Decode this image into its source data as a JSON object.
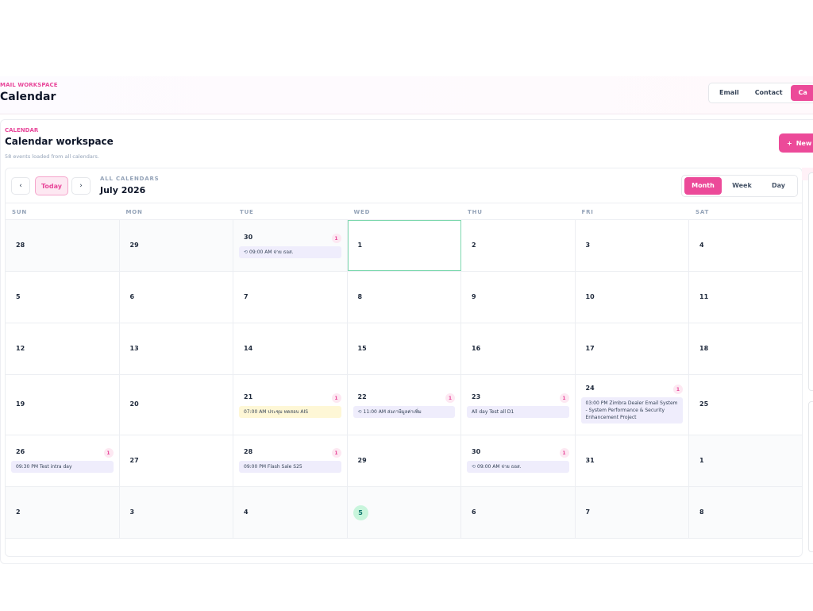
{
  "app": {
    "kicker": "MAIL WORKSPACE",
    "title": "Calendar",
    "nav": [
      {
        "label": "Email",
        "active": false
      },
      {
        "label": "Contact",
        "active": false
      },
      {
        "label": "Ca",
        "active": true
      }
    ]
  },
  "workspace": {
    "kicker": "CALENDAR",
    "title": "Calendar workspace",
    "subtitle": "58 events loaded from all calendars.",
    "new_button": "New",
    "new_icon": "plus-icon"
  },
  "toolbar": {
    "prev_icon": "‹",
    "next_icon": "›",
    "today_label": "Today",
    "kicker": "ALL CALENDARS",
    "month_label": "July 2026",
    "views": [
      {
        "label": "Month",
        "active": true
      },
      {
        "label": "Week",
        "active": false
      },
      {
        "label": "Day",
        "active": false
      }
    ]
  },
  "weekdays": [
    "SUN",
    "MON",
    "TUE",
    "WED",
    "THU",
    "FRI",
    "SAT"
  ],
  "colors": {
    "accent": "#ec4a99",
    "event_bg": "#efedfc",
    "event_yellow": "#fef7d6",
    "today": "#c8f5dc"
  },
  "weeks": [
    [
      {
        "day": "28",
        "muted": true
      },
      {
        "day": "29",
        "muted": true
      },
      {
        "day": "30",
        "muted": true,
        "count": "1",
        "events": [
          {
            "text": "09:00 AM จ่าย ธอส.",
            "recurring": true
          }
        ]
      },
      {
        "day": "1",
        "selected": true
      },
      {
        "day": "2"
      },
      {
        "day": "3"
      },
      {
        "day": "4"
      }
    ],
    [
      {
        "day": "5"
      },
      {
        "day": "6"
      },
      {
        "day": "7"
      },
      {
        "day": "8"
      },
      {
        "day": "9"
      },
      {
        "day": "10"
      },
      {
        "day": "11"
      }
    ],
    [
      {
        "day": "12"
      },
      {
        "day": "13"
      },
      {
        "day": "14"
      },
      {
        "day": "15"
      },
      {
        "day": "16"
      },
      {
        "day": "17"
      },
      {
        "day": "18"
      }
    ],
    [
      {
        "day": "19"
      },
      {
        "day": "20"
      },
      {
        "day": "21",
        "count": "1",
        "events": [
          {
            "text": "07:00 AM ประชุม ทดสอบ AIS",
            "color": "yellow"
          }
        ]
      },
      {
        "day": "22",
        "count": "1",
        "events": [
          {
            "text": "11:00 AM ส่งภาษีมูลค่าเพิ่ม",
            "recurring": true
          }
        ]
      },
      {
        "day": "23",
        "count": "1",
        "events": [
          {
            "text": "All day Test all D1"
          }
        ]
      },
      {
        "day": "24",
        "count": "1",
        "top": true,
        "events": [
          {
            "text": "03:00 PM Zimbra Dealer Email System - System Performance & Security Enhancement Project"
          }
        ]
      },
      {
        "day": "25"
      }
    ],
    [
      {
        "day": "26",
        "count": "1",
        "events": [
          {
            "text": "09:30 PM Test intra day"
          }
        ]
      },
      {
        "day": "27"
      },
      {
        "day": "28",
        "count": "1",
        "events": [
          {
            "text": "09:00 PM Flash Sale S25"
          }
        ]
      },
      {
        "day": "29"
      },
      {
        "day": "30",
        "count": "1",
        "events": [
          {
            "text": "09:00 AM จ่าย ธอส.",
            "recurring": true
          }
        ]
      },
      {
        "day": "31"
      },
      {
        "day": "1",
        "muted": true
      }
    ],
    [
      {
        "day": "2",
        "muted": true
      },
      {
        "day": "3",
        "muted": true
      },
      {
        "day": "4",
        "muted": true
      },
      {
        "day": "5",
        "muted": true,
        "today": true
      },
      {
        "day": "6",
        "muted": true
      },
      {
        "day": "7",
        "muted": true
      },
      {
        "day": "8",
        "muted": true
      }
    ]
  ]
}
